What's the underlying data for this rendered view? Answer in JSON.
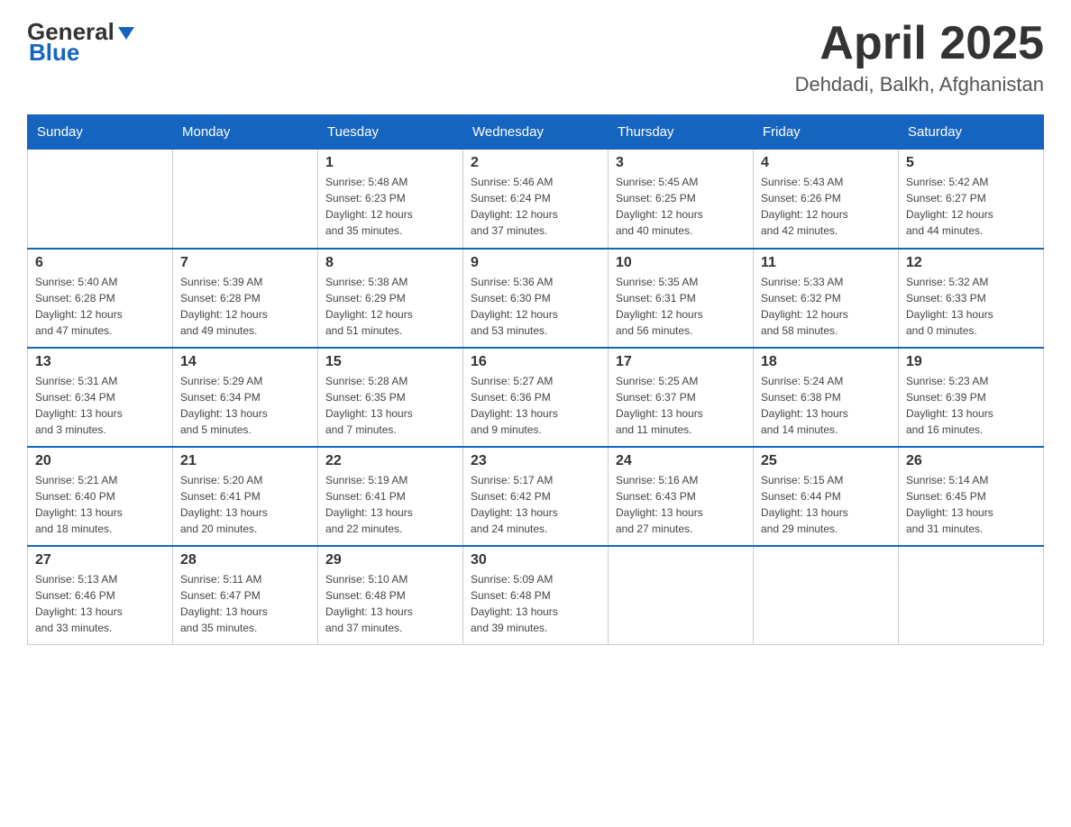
{
  "header": {
    "logo": {
      "general": "General",
      "blue": "Blue"
    },
    "title": "April 2025",
    "location": "Dehdadi, Balkh, Afghanistan"
  },
  "days_of_week": [
    "Sunday",
    "Monday",
    "Tuesday",
    "Wednesday",
    "Thursday",
    "Friday",
    "Saturday"
  ],
  "weeks": [
    [
      {
        "day": "",
        "info": ""
      },
      {
        "day": "",
        "info": ""
      },
      {
        "day": "1",
        "info": "Sunrise: 5:48 AM\nSunset: 6:23 PM\nDaylight: 12 hours\nand 35 minutes."
      },
      {
        "day": "2",
        "info": "Sunrise: 5:46 AM\nSunset: 6:24 PM\nDaylight: 12 hours\nand 37 minutes."
      },
      {
        "day": "3",
        "info": "Sunrise: 5:45 AM\nSunset: 6:25 PM\nDaylight: 12 hours\nand 40 minutes."
      },
      {
        "day": "4",
        "info": "Sunrise: 5:43 AM\nSunset: 6:26 PM\nDaylight: 12 hours\nand 42 minutes."
      },
      {
        "day": "5",
        "info": "Sunrise: 5:42 AM\nSunset: 6:27 PM\nDaylight: 12 hours\nand 44 minutes."
      }
    ],
    [
      {
        "day": "6",
        "info": "Sunrise: 5:40 AM\nSunset: 6:28 PM\nDaylight: 12 hours\nand 47 minutes."
      },
      {
        "day": "7",
        "info": "Sunrise: 5:39 AM\nSunset: 6:28 PM\nDaylight: 12 hours\nand 49 minutes."
      },
      {
        "day": "8",
        "info": "Sunrise: 5:38 AM\nSunset: 6:29 PM\nDaylight: 12 hours\nand 51 minutes."
      },
      {
        "day": "9",
        "info": "Sunrise: 5:36 AM\nSunset: 6:30 PM\nDaylight: 12 hours\nand 53 minutes."
      },
      {
        "day": "10",
        "info": "Sunrise: 5:35 AM\nSunset: 6:31 PM\nDaylight: 12 hours\nand 56 minutes."
      },
      {
        "day": "11",
        "info": "Sunrise: 5:33 AM\nSunset: 6:32 PM\nDaylight: 12 hours\nand 58 minutes."
      },
      {
        "day": "12",
        "info": "Sunrise: 5:32 AM\nSunset: 6:33 PM\nDaylight: 13 hours\nand 0 minutes."
      }
    ],
    [
      {
        "day": "13",
        "info": "Sunrise: 5:31 AM\nSunset: 6:34 PM\nDaylight: 13 hours\nand 3 minutes."
      },
      {
        "day": "14",
        "info": "Sunrise: 5:29 AM\nSunset: 6:34 PM\nDaylight: 13 hours\nand 5 minutes."
      },
      {
        "day": "15",
        "info": "Sunrise: 5:28 AM\nSunset: 6:35 PM\nDaylight: 13 hours\nand 7 minutes."
      },
      {
        "day": "16",
        "info": "Sunrise: 5:27 AM\nSunset: 6:36 PM\nDaylight: 13 hours\nand 9 minutes."
      },
      {
        "day": "17",
        "info": "Sunrise: 5:25 AM\nSunset: 6:37 PM\nDaylight: 13 hours\nand 11 minutes."
      },
      {
        "day": "18",
        "info": "Sunrise: 5:24 AM\nSunset: 6:38 PM\nDaylight: 13 hours\nand 14 minutes."
      },
      {
        "day": "19",
        "info": "Sunrise: 5:23 AM\nSunset: 6:39 PM\nDaylight: 13 hours\nand 16 minutes."
      }
    ],
    [
      {
        "day": "20",
        "info": "Sunrise: 5:21 AM\nSunset: 6:40 PM\nDaylight: 13 hours\nand 18 minutes."
      },
      {
        "day": "21",
        "info": "Sunrise: 5:20 AM\nSunset: 6:41 PM\nDaylight: 13 hours\nand 20 minutes."
      },
      {
        "day": "22",
        "info": "Sunrise: 5:19 AM\nSunset: 6:41 PM\nDaylight: 13 hours\nand 22 minutes."
      },
      {
        "day": "23",
        "info": "Sunrise: 5:17 AM\nSunset: 6:42 PM\nDaylight: 13 hours\nand 24 minutes."
      },
      {
        "day": "24",
        "info": "Sunrise: 5:16 AM\nSunset: 6:43 PM\nDaylight: 13 hours\nand 27 minutes."
      },
      {
        "day": "25",
        "info": "Sunrise: 5:15 AM\nSunset: 6:44 PM\nDaylight: 13 hours\nand 29 minutes."
      },
      {
        "day": "26",
        "info": "Sunrise: 5:14 AM\nSunset: 6:45 PM\nDaylight: 13 hours\nand 31 minutes."
      }
    ],
    [
      {
        "day": "27",
        "info": "Sunrise: 5:13 AM\nSunset: 6:46 PM\nDaylight: 13 hours\nand 33 minutes."
      },
      {
        "day": "28",
        "info": "Sunrise: 5:11 AM\nSunset: 6:47 PM\nDaylight: 13 hours\nand 35 minutes."
      },
      {
        "day": "29",
        "info": "Sunrise: 5:10 AM\nSunset: 6:48 PM\nDaylight: 13 hours\nand 37 minutes."
      },
      {
        "day": "30",
        "info": "Sunrise: 5:09 AM\nSunset: 6:48 PM\nDaylight: 13 hours\nand 39 minutes."
      },
      {
        "day": "",
        "info": ""
      },
      {
        "day": "",
        "info": ""
      },
      {
        "day": "",
        "info": ""
      }
    ]
  ]
}
